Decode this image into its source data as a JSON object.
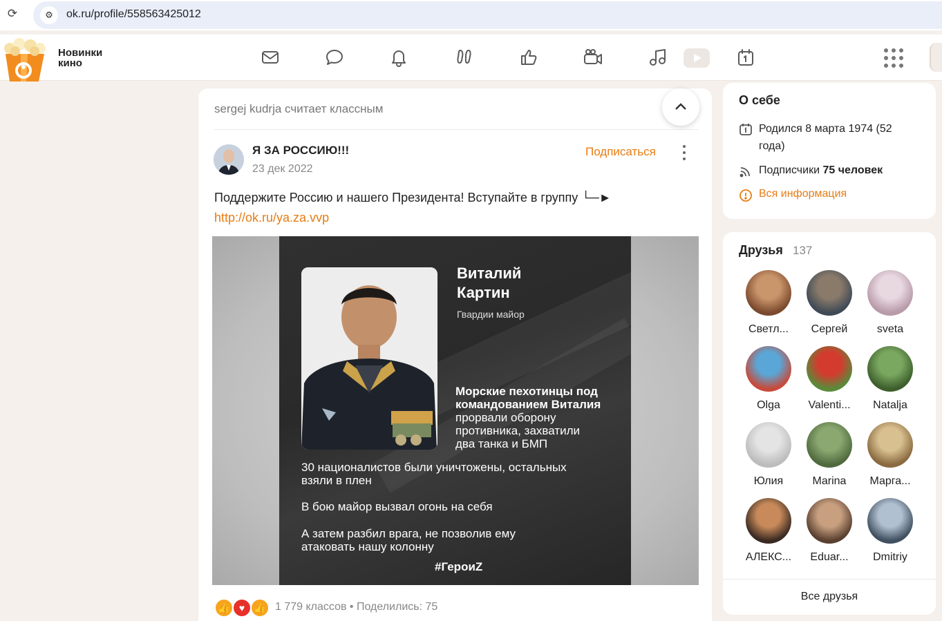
{
  "browser": {
    "url": "ok.ru/profile/558563425012"
  },
  "header": {
    "brand_line1": "Новинки",
    "brand_line2": "кино",
    "icons": [
      "mail-icon",
      "chat-icon",
      "bell-icon",
      "guests-icon",
      "like-icon",
      "camera-icon",
      "music-icon",
      "video-icon",
      "calendar-icon",
      "apps-grid-icon"
    ]
  },
  "feed": {
    "klass_line": "sergej kudrja считает классным",
    "post": {
      "author": "Я ЗА РОССИЮ!!!",
      "date": "23 дек 2022",
      "subscribe_label": "Подписаться",
      "text": "Поддержите Россию и нашего Президента! Вступайте в группу └─►",
      "link": "http://ok.ru/ya.za.vvp",
      "image": {
        "name_line1": "Виталий",
        "name_line2": "Картин",
        "rank": "Гвардии майор",
        "bold_line1": "Морские пехотинцы под",
        "bold_line2": "командованием Виталия",
        "normal_line1": "прорвали оборону",
        "normal_line2": "противника, захватили",
        "normal_line3": "два танка и БМП",
        "p2_line1": "30 националистов были уничтожены, остальных",
        "p2_line2": "взяли в плен",
        "p3": "В бою майор вызвал огонь на себя",
        "p4_line1": "А затем разбил врага, не позволив ему",
        "p4_line2": "атаковать нашу колонну",
        "hashtag": "#ГероиZ"
      },
      "stats": "1 779 классов  •  Поделились: 75"
    }
  },
  "about": {
    "title": "О себе",
    "born_line1": "Родился 8 марта 1974 (52",
    "born_line2": "года)",
    "subscribers_label": "Подписчики",
    "subscribers_value": "75 человек",
    "all_info": "Вся информация"
  },
  "friends": {
    "title": "Друзья",
    "count": "137",
    "items": [
      {
        "name": "Светл...",
        "c1": "#c9956b",
        "c2": "#7b4a2e"
      },
      {
        "name": "Сергей",
        "c1": "#8a7a6a",
        "c2": "#3f4a55"
      },
      {
        "name": "sveta",
        "c1": "#e8d8e0",
        "c2": "#b89aa8"
      },
      {
        "name": "Olga",
        "c1": "#5aa6d6",
        "c2": "#c84a3a"
      },
      {
        "name": "Valenti...",
        "c1": "#d43b2f",
        "c2": "#5a8a3a"
      },
      {
        "name": "Natalja",
        "c1": "#7aa860",
        "c2": "#3e5f2d"
      },
      {
        "name": "Юлия",
        "c1": "#e4e4e4",
        "c2": "#bcbcbc"
      },
      {
        "name": "Marina",
        "c1": "#8aa870",
        "c2": "#506a3e"
      },
      {
        "name": "Марга...",
        "c1": "#d8c090",
        "c2": "#8a6a40"
      },
      {
        "name": "АЛЕКС...",
        "c1": "#c88a5a",
        "c2": "#3a2a22"
      },
      {
        "name": "Eduar...",
        "c1": "#c8a080",
        "c2": "#5a4030"
      },
      {
        "name": "Dmitriy",
        "c1": "#b0c0d0",
        "c2": "#405060"
      }
    ],
    "all_label": "Все друзья"
  }
}
